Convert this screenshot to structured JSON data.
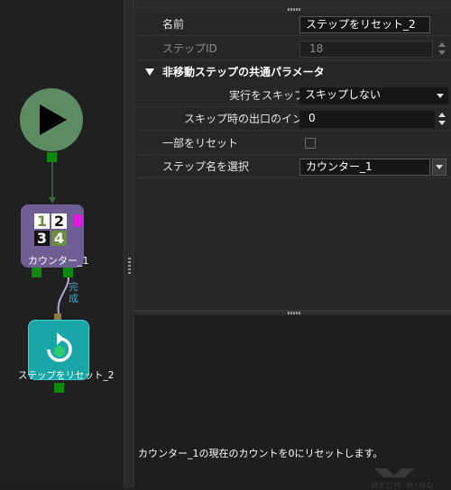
{
  "canvas": {
    "counter_node": {
      "label": "カウンター_1",
      "digits": [
        "1",
        "2",
        "3",
        "4"
      ]
    },
    "connection_label": "完成",
    "reset_node": {
      "label": "ステップをリセット_2"
    }
  },
  "properties": {
    "name_label": "名前",
    "name_value": "ステップをリセット_2",
    "step_id_label": "ステップID",
    "step_id_value": "18",
    "section_title": "非移動ステップの共通パラメータ",
    "skip_label": "実行をスキップ",
    "skip_value": "スキップしない",
    "exit_label": "スキップ時の出口のイン…",
    "exit_value": "0",
    "partial_reset_label": "一部をリセット",
    "select_step_label": "ステップ名を選択",
    "select_step_value": "カウンター_1"
  },
  "description": "カウンター_1の現在のカウントを0にリセットします。",
  "watermark": "MECH MIND",
  "colors": {
    "start_node": "#5e8c62",
    "counter_node": "#6f5e93",
    "reset_node": "#1aa6a6",
    "port": "#0d8a0d",
    "connection_label": "#48a4c6"
  },
  "icons": [
    "play-icon",
    "counter-digits-icon",
    "reset-icon",
    "dropdown-arrow-icon",
    "spin-arrows-icon"
  ]
}
